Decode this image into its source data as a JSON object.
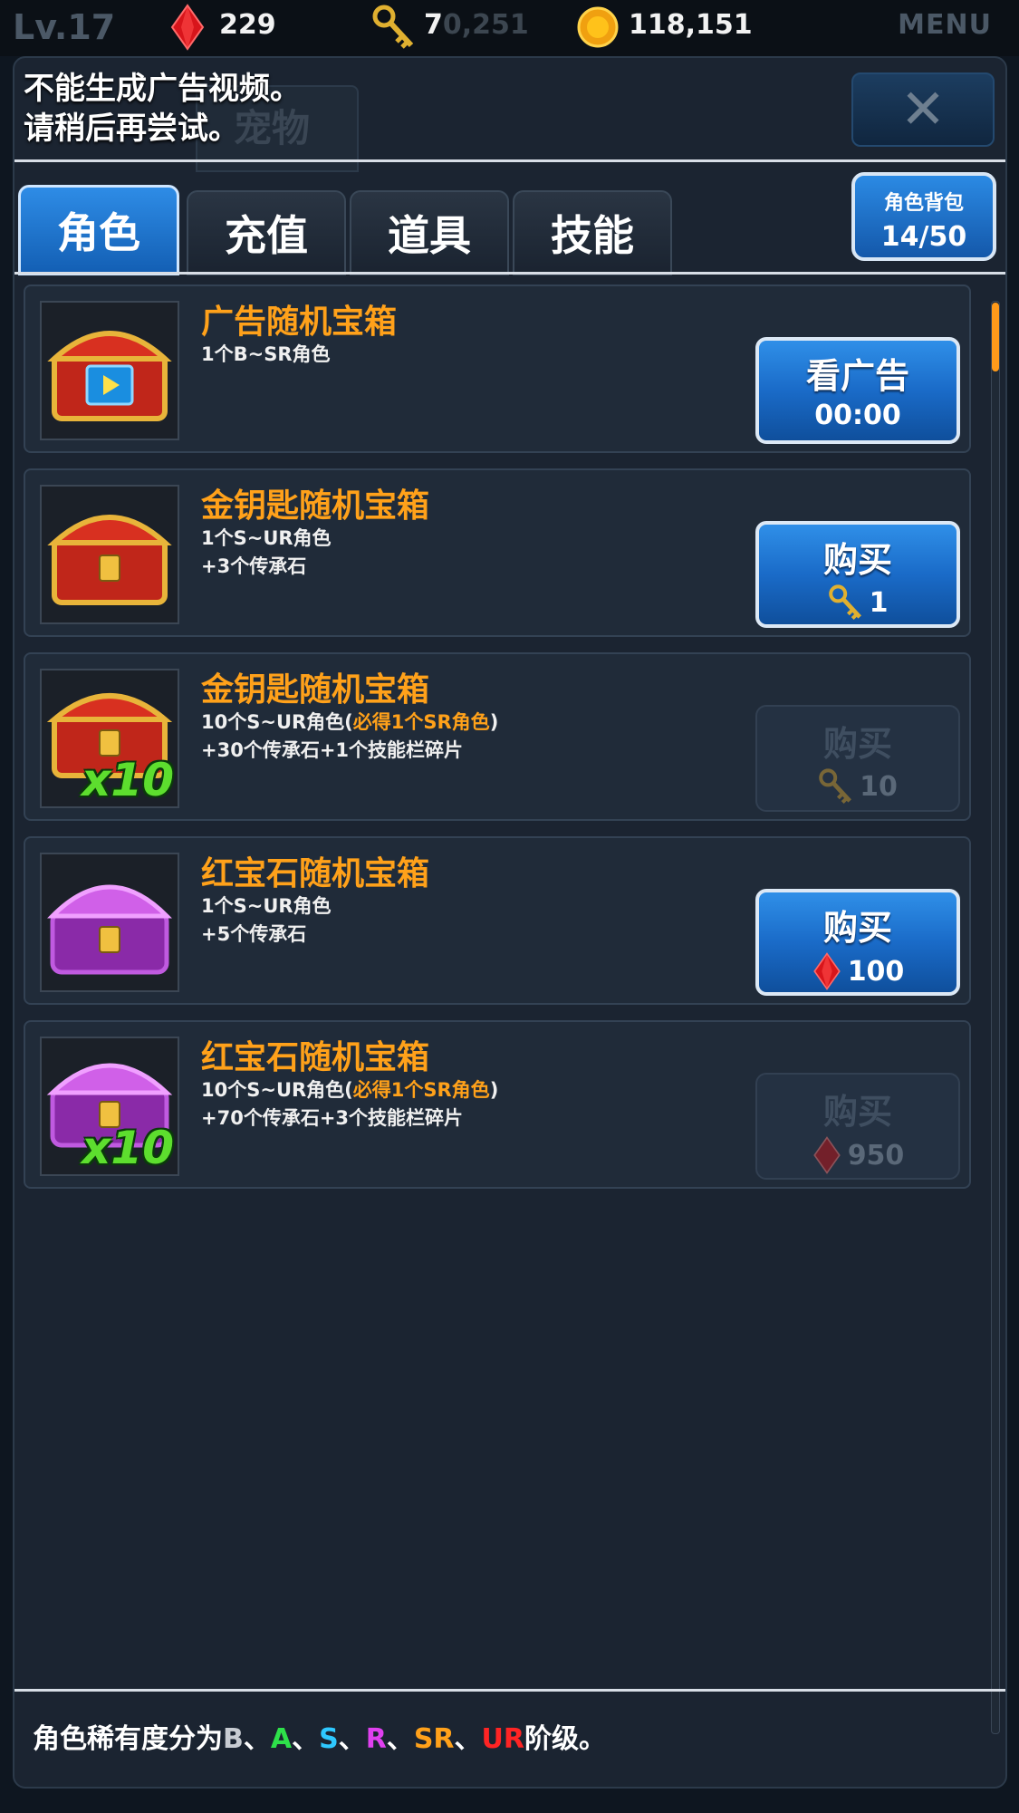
{
  "status_bar": {
    "level": "Lv.17",
    "rubies": "229",
    "keys": "7",
    "keys_faint": "0,251",
    "gold": "118,151",
    "menu": "MENU"
  },
  "toast": {
    "line1": "不能生成广告视频。",
    "line2": "请稍后再尝试。"
  },
  "ghost_tab": "宠物",
  "tabs": [
    {
      "label": "角色",
      "active": true
    },
    {
      "label": "充值",
      "active": false
    },
    {
      "label": "道具",
      "active": false
    },
    {
      "label": "技能",
      "active": false
    }
  ],
  "bag": {
    "label": "角色背包",
    "count": "14/50"
  },
  "items": [
    {
      "title": "广告随机宝箱",
      "desc1": "1个B~SR角色",
      "desc2": "",
      "button": {
        "label": "看广告",
        "price": "00:00",
        "enabled": true,
        "currency": "ad"
      },
      "chest": "red-ad-chest"
    },
    {
      "title": "金钥匙随机宝箱",
      "desc1": "1个S~UR角色",
      "desc2": "+3个传承石",
      "button": {
        "label": "购买",
        "price": "1",
        "enabled": true,
        "currency": "key"
      },
      "chest": "red-gold-chest"
    },
    {
      "title": "金钥匙随机宝箱",
      "desc1a": "10个S~UR角色(",
      "desc1_highlight": "必得1个SR角色",
      "desc1b": ")",
      "desc2": "+30个传承石+1个技能栏碎片",
      "badge": "x10",
      "button": {
        "label": "购买",
        "price": "10",
        "enabled": false,
        "currency": "key"
      },
      "chest": "red-gold-chest"
    },
    {
      "title": "红宝石随机宝箱",
      "desc1": "1个S~UR角色",
      "desc2": "+5个传承石",
      "button": {
        "label": "购买",
        "price": "100",
        "enabled": true,
        "currency": "ruby"
      },
      "chest": "purple-chest"
    },
    {
      "title": "红宝石随机宝箱",
      "desc1a": "10个S~UR角色(",
      "desc1_highlight": "必得1个SR角色",
      "desc1b": ")",
      "desc2": "+70个传承石+3个技能栏碎片",
      "badge": "x10",
      "button": {
        "label": "购买",
        "price": "950",
        "enabled": false,
        "currency": "ruby"
      },
      "chest": "purple-chest"
    }
  ],
  "footer": {
    "prefix": "角色稀有度分为",
    "b": "B",
    "a": "A",
    "s": "S",
    "r": "R",
    "sr": "SR",
    "ur": "UR",
    "sep": "、",
    "suffix": "阶级。"
  },
  "colors": {
    "title_orange": "#ffa11a",
    "button_blue": "#1a6bc8",
    "rarity_a": "#2ee04a",
    "rarity_s": "#2ec8ff",
    "rarity_r": "#e040f0",
    "rarity_ur": "#ff2424"
  },
  "icons": [
    "ruby-icon",
    "key-icon",
    "gold-coin-icon",
    "close-icon",
    "video-icon",
    "chest-icon"
  ]
}
